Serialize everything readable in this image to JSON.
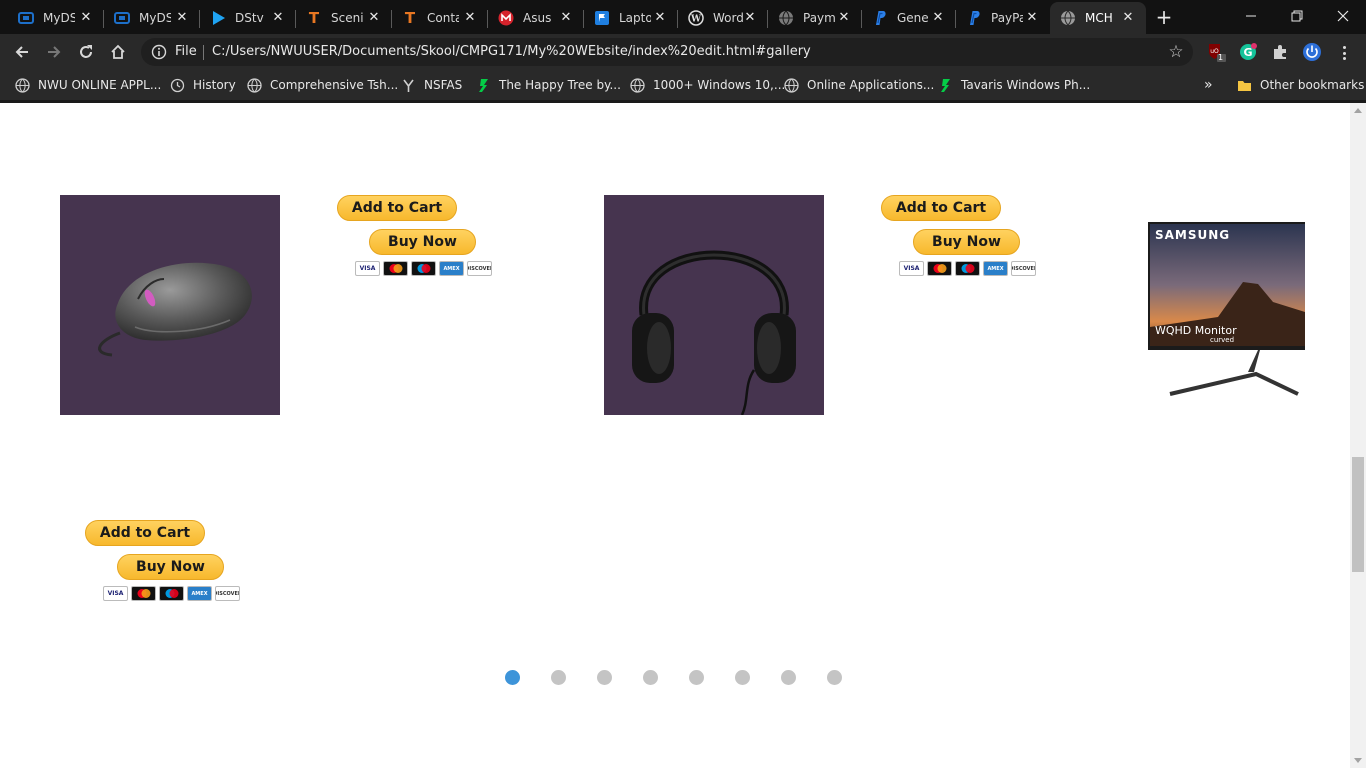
{
  "browser": {
    "tabs": [
      {
        "title": "MyDS",
        "icon": "myds-icon",
        "color": "#1d6fc9"
      },
      {
        "title": "MyDS",
        "icon": "myds-icon",
        "color": "#1d6fc9"
      },
      {
        "title": "DStv",
        "icon": "dstv-play-icon",
        "color": "#1fa3f2"
      },
      {
        "title": "Scenic",
        "icon": "t-letter-icon",
        "color": "#e87722"
      },
      {
        "title": "Contact",
        "icon": "t-letter-icon",
        "color": "#e87722"
      },
      {
        "title": "Asus",
        "icon": "m-circle-icon",
        "color": "#d6232c"
      },
      {
        "title": "Laptop",
        "icon": "flag-icon",
        "color": "#1f7fe0"
      },
      {
        "title": "WordPress",
        "icon": "wordpress-icon",
        "color": "#e0e0e0"
      },
      {
        "title": "Payment",
        "icon": "globe-icon",
        "color": "#7a7a7a"
      },
      {
        "title": "Generate",
        "icon": "paypal-icon",
        "color": "#2b7fe8"
      },
      {
        "title": "PayPal",
        "icon": "paypal-icon",
        "color": "#2b7fe8"
      },
      {
        "title": "MCH",
        "icon": "globe-icon",
        "color": "#9a9a9a",
        "active": true
      }
    ],
    "new_tab_label": "+",
    "close_glyph": "✕",
    "address": {
      "scheme": "File",
      "url": "C:/Users/NWUUSER/Documents/Skool/CMPG171/My%20WEbsite/index%20edit.html#gallery"
    },
    "extensions": {
      "ublock_badge": "1"
    },
    "bookmarks": [
      {
        "label": "NWU ONLINE APPL...",
        "icon": "globe-icon"
      },
      {
        "label": "History",
        "icon": "history-icon"
      },
      {
        "label": "Comprehensive Tsh...",
        "icon": "globe-icon"
      },
      {
        "label": "NSFAS",
        "icon": "nsfas-icon"
      },
      {
        "label": "The Happy Tree by...",
        "icon": "deviantart-icon"
      },
      {
        "label": "1000+ Windows 10,...",
        "icon": "globe-icon"
      },
      {
        "label": "Online Applications...",
        "icon": "globe-icon"
      },
      {
        "label": "Tavaris Windows Ph...",
        "icon": "deviantart-icon"
      }
    ],
    "bookmarks_overflow": "»",
    "other_bookmarks": "Other bookmarks"
  },
  "gallery": {
    "products": [
      {
        "image": "gaming-mouse-image",
        "add_to_cart": "Add to Cart",
        "buy_now": "Buy Now"
      },
      {
        "image": "headphones-image",
        "add_to_cart": "Add to Cart",
        "buy_now": "Buy Now"
      },
      {
        "image": "monitor-image",
        "monitor_brand": "SAMSUNG",
        "monitor_model": "WQHD Monitor",
        "monitor_tag": "curved",
        "add_to_cart": "Add to Cart",
        "buy_now": "Buy Now"
      }
    ],
    "payment_cards": [
      "VISA",
      "mastercard",
      "maestro",
      "AMERICAN EXPRESS",
      "DISCOVER"
    ],
    "carousel": {
      "count": 8,
      "active_index": 0
    },
    "colors": {
      "image_bg": "#46344f",
      "button_yellow": "#ffc439",
      "dot_active": "#3d94d9",
      "dot_inactive": "#c4c4c4"
    }
  }
}
